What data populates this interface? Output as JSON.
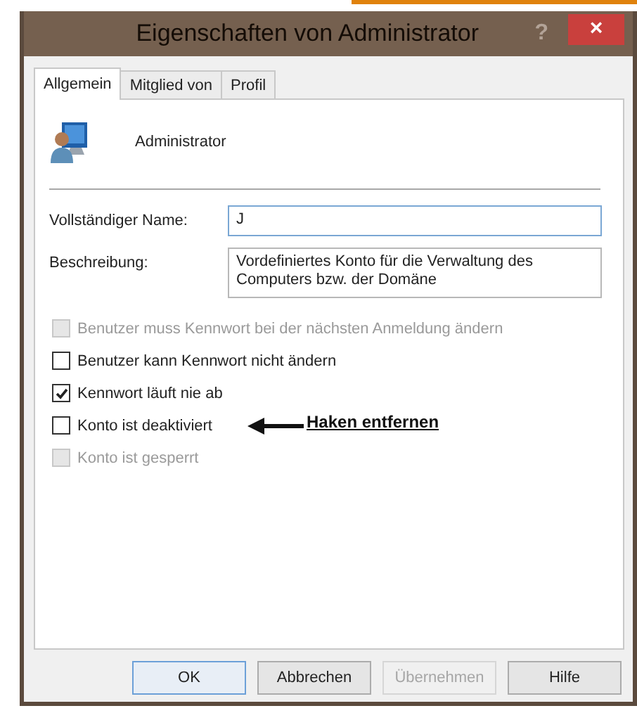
{
  "window": {
    "title": "Eigenschaften von Administrator",
    "help": "?",
    "close": "×"
  },
  "tabs": [
    {
      "label": "Allgemein",
      "selected": true
    },
    {
      "label": "Mitglied von",
      "selected": false
    },
    {
      "label": "Profil",
      "selected": false
    }
  ],
  "account": {
    "name": "Administrator"
  },
  "fields": [
    {
      "kind": "line",
      "label": "Vollständiger Name:",
      "value": "J",
      "focused": true
    },
    {
      "kind": "multiline",
      "label": "Beschreibung:",
      "value": "Vordefiniertes Konto für die Verwaltung des Computers bzw. der Domäne",
      "focused": false
    }
  ],
  "options": [
    {
      "label": "Benutzer muss Kennwort bei der nächsten Anmeldung ändern",
      "checked": false,
      "disabled": true
    },
    {
      "label": "Benutzer kann Kennwort nicht ändern",
      "checked": false,
      "disabled": false
    },
    {
      "label": "Kennwort läuft nie ab",
      "checked": true,
      "disabled": false
    },
    {
      "label": "Konto ist deaktiviert",
      "checked": false,
      "disabled": false,
      "annotation": "Haken entfernen"
    },
    {
      "label": "Konto ist gesperrt",
      "checked": false,
      "disabled": true
    }
  ],
  "buttons": [
    {
      "label": "OK",
      "default": true,
      "disabled": false
    },
    {
      "label": "Abbrechen",
      "default": false,
      "disabled": false
    },
    {
      "label": "Übernehmen",
      "default": false,
      "disabled": true
    },
    {
      "label": "Hilfe",
      "default": false,
      "disabled": false
    }
  ]
}
